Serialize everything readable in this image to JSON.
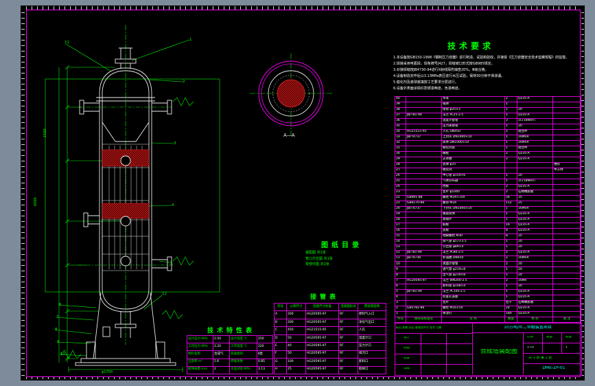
{
  "tech_requirements": {
    "title": "技术要求",
    "items": [
      "1.本设备按GB150-1998《钢制压力容器》进行制造、试验和验收，并接受《压力容器安全技术监察规程》的监督。",
      "2.焊接采用电弧焊，焊条牌号J427，焊缝坡口形式按GB985规定。",
      "3.对接焊缝按JB4730-94进行X射线探伤抽查20%，Ⅲ级合格。",
      "4.设备制造完毕后以3.13MPa表压进行水压试验，保持30分钟不得渗漏。",
      "5.催化剂及瓷球装填按工艺要求分层进行。",
      "6.设备外表面涂铁红防锈漆两道，色漆两道。"
    ]
  },
  "bom": {
    "headers": [
      "件号",
      "图号或标准号",
      "名  称",
      "数量",
      "材  料",
      "备  注"
    ],
    "rows": [
      [
        "40",
        "",
        "吊耳",
        "2",
        "Q235-A",
        ""
      ],
      [
        "39",
        "",
        "铭牌",
        "1",
        "",
        ""
      ],
      [
        "38",
        "",
        "接管 φ25×3",
        "1",
        "20",
        ""
      ],
      [
        "37",
        "JB/T81-94",
        "法兰 PL25-2.5",
        "1",
        "Q235-A",
        ""
      ],
      [
        "36",
        "",
        "温度计套管",
        "3",
        "1Cr18Ni9Ti",
        ""
      ],
      [
        "35",
        "",
        "压力表接管",
        "1",
        "20",
        ""
      ],
      [
        "34",
        "HG21515-95",
        "人孔 DN450",
        "2",
        "组合件",
        ""
      ],
      [
        "33",
        "JB/T4737",
        "上封头 DN1000×10",
        "1",
        "16MnR",
        ""
      ],
      [
        "32",
        "",
        "筒体 DN1000×10",
        "1",
        "16MnR",
        ""
      ],
      [
        "31",
        "",
        "催化剂筐",
        "1",
        "组合件",
        ""
      ],
      [
        "30",
        "",
        "栅板",
        "2",
        "Q235-A",
        ""
      ],
      [
        "29",
        "",
        "支承圈",
        "2",
        "Q235-A",
        ""
      ],
      [
        "28",
        "",
        "瓷球 φ25",
        "",
        "",
        "堆装"
      ],
      [
        "27",
        "",
        "催化剂",
        "",
        "",
        "甲方供"
      ],
      [
        "26",
        "",
        "中心管 φ159×6",
        "1",
        "20",
        ""
      ],
      [
        "25",
        "",
        "气体分布器",
        "1",
        "1Cr18Ni9Ti",
        ""
      ],
      [
        "24",
        "",
        "挡板",
        "2",
        "Q235-A",
        ""
      ],
      [
        "23",
        "",
        "垫片 φ1040",
        "2",
        "石棉橡胶板",
        ""
      ],
      [
        "22",
        "GB901-88",
        "螺柱 M24×150",
        "56",
        "35",
        ""
      ],
      [
        "21",
        "GB6170-86",
        "螺母 M24",
        "112",
        "25",
        ""
      ],
      [
        "20",
        "JB/T4737",
        "下封头 DN1000×10",
        "1",
        "16MnR",
        ""
      ],
      [
        "19",
        "",
        "裙座筒体",
        "1",
        "Q235-A",
        ""
      ],
      [
        "18",
        "",
        "基础环",
        "1",
        "Q235-A",
        ""
      ],
      [
        "17",
        "",
        "筋板",
        "16",
        "Q235-A",
        ""
      ],
      [
        "16",
        "",
        "盖板",
        "8",
        "Q235-A",
        ""
      ],
      [
        "15",
        "",
        "地脚螺栓 M30",
        "8",
        "35",
        ""
      ],
      [
        "14",
        "",
        "排气管 φ57×3.5",
        "1",
        "20",
        ""
      ],
      [
        "13",
        "",
        "引出管 φ89×4",
        "1",
        "20",
        ""
      ],
      [
        "12",
        "JB/T81-94",
        "法兰 PL80-2.5",
        "2",
        "Q235-A",
        ""
      ],
      [
        "11",
        "JB/T4736",
        "补强圈 DN450",
        "2",
        "16MnR",
        ""
      ],
      [
        "10",
        "",
        "液面计接管",
        "2",
        "20",
        ""
      ],
      [
        "9",
        "",
        "进气管 φ219×8",
        "1",
        "20",
        ""
      ],
      [
        "8",
        "",
        "出气管 φ219×8",
        "1",
        "20",
        ""
      ],
      [
        "7",
        "HG20595-97",
        "法兰 WN200-2.5",
        "2",
        "16Mn",
        ""
      ],
      [
        "6",
        "",
        "卸料管 φ108×4",
        "1",
        "20",
        ""
      ],
      [
        "5",
        "JB/T81-94",
        "法兰 PL100-2.5",
        "1",
        "Q235-A",
        ""
      ],
      [
        "4",
        "",
        "检查孔盖板",
        "1",
        "Q235-A",
        ""
      ],
      [
        "3",
        "",
        "垫片",
        "若干",
        "石棉橡胶板",
        ""
      ],
      [
        "2",
        "GB5782-86",
        "螺栓 M16×50",
        "24",
        "Q235-A",
        ""
      ],
      [
        "1",
        "",
        "保温钉",
        "180",
        "Q235-A",
        ""
      ]
    ]
  },
  "catalog": {
    "title": "图纸目录",
    "lines": [
      "装配图  共1张",
      "管口方位图  共1张",
      "零部件图  共2张"
    ]
  },
  "nozzle_table": {
    "title": "接管表",
    "headers": [
      "符号",
      "公称尺寸",
      "连接尺寸标准",
      "连接面形式",
      "用途或名称"
    ],
    "rows": [
      [
        "A",
        "200",
        "HG20595-97",
        "RF",
        "原料气入口"
      ],
      [
        "B",
        "200",
        "HG20595-97",
        "RF",
        "净化气出口"
      ],
      [
        "C",
        "450",
        "HG21515-95",
        "RF",
        "人孔"
      ],
      [
        "D",
        "50",
        "HG20595-97",
        "RF",
        "温度计口"
      ],
      [
        "E",
        "40",
        "HG20595-97",
        "RF",
        "压力计口"
      ],
      [
        "F",
        "50",
        "HG20595-97",
        "RF",
        "排污口"
      ],
      [
        "G",
        "100",
        "HG20595-97",
        "RF",
        "卸料口"
      ],
      [
        "H",
        "25",
        "HG20595-97",
        "RF",
        "取样口"
      ]
    ]
  },
  "tech_spec": {
    "title": "技术特性表",
    "rows": [
      [
        "设计压力 MPa",
        "2.50",
        "设计温度 ℃",
        "250"
      ],
      [
        "工作压力 MPa",
        "2.20",
        "工作温度 ℃",
        "220"
      ],
      [
        "物料名称",
        "合成气",
        "容器类别",
        "Ⅱ类"
      ],
      [
        "全容积 m³",
        "5.6",
        "焊缝系数",
        "0.85"
      ],
      [
        "腐蚀裕量 mm",
        "2",
        "水压试验 MPa",
        "3.13"
      ]
    ]
  },
  "title_block": {
    "project": "10万吨/年二甲醚装置项目",
    "drawing_title": "合成塔装配图",
    "drawing_no": "DME-ZP-01",
    "rev_row": "标记 处数 分区 更改文件号 签字 日期",
    "left_rows": [
      "设计",
      "制图",
      "校核",
      "审核"
    ],
    "scale_label": "比例",
    "mass_label": "质量",
    "qty_label": "数量",
    "scale": "1:10",
    "qty": "1",
    "sheet": "共 1 张  第 1 张"
  },
  "section_view": {
    "label": "A—A"
  },
  "drawing": {
    "callouts": [
      "1",
      "2",
      "3",
      "4",
      "5",
      "6",
      "7",
      "8",
      "9",
      "10",
      "11",
      "12"
    ],
    "dims": {
      "d1": "6000",
      "d2": "1500",
      "d3": "φ1700"
    }
  }
}
